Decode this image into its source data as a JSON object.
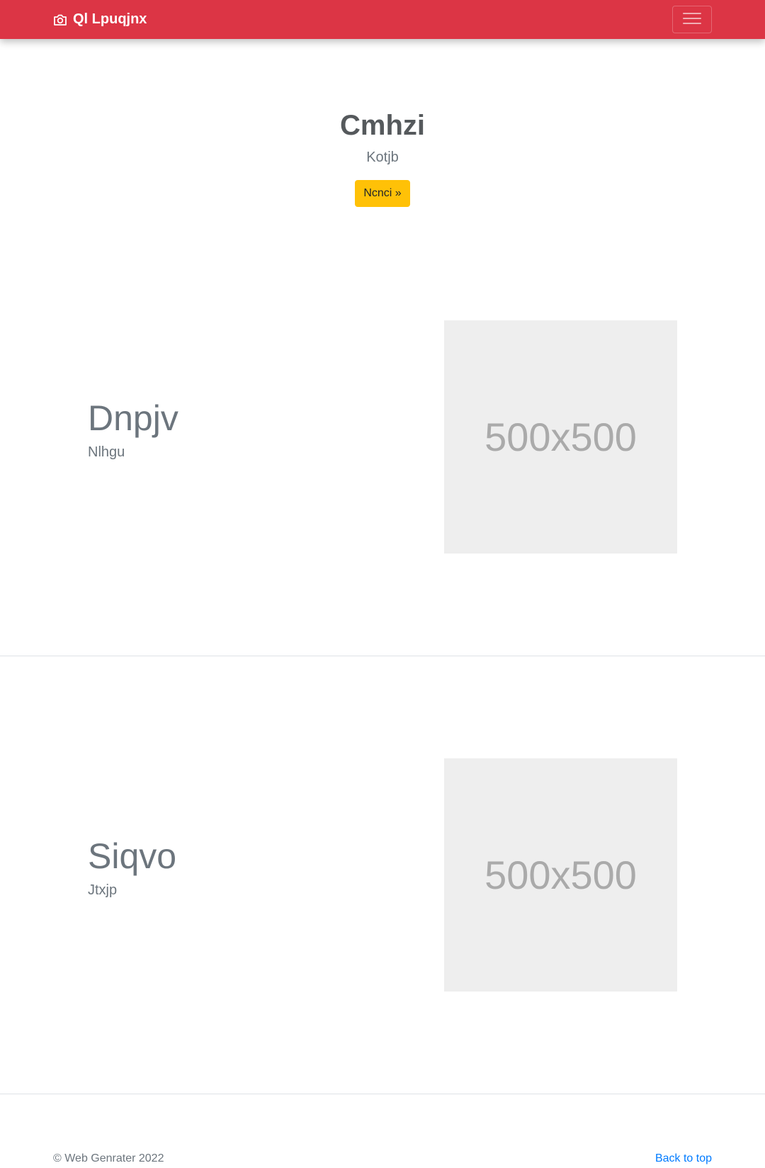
{
  "navbar": {
    "brand_text": "Ql Lpuqjnx",
    "brand_icon": "camera-icon",
    "toggle_icon": "hamburger-menu-icon",
    "background_color": "#dc3545"
  },
  "hero": {
    "title": "Cmhzi",
    "subtitle": "Kotjb",
    "button_label": "Ncnci »",
    "button_color": "#ffc107"
  },
  "features": [
    {
      "heading": "Dnpjv",
      "lead": "Nlhgu",
      "image_text": "500x500"
    },
    {
      "heading": "Siqvo",
      "lead": "Jtxjp",
      "image_text": "500x500"
    }
  ],
  "footer": {
    "copyright": "© Web Genrater 2022",
    "back_to_top": "Back to top",
    "link_color": "#007bff"
  }
}
